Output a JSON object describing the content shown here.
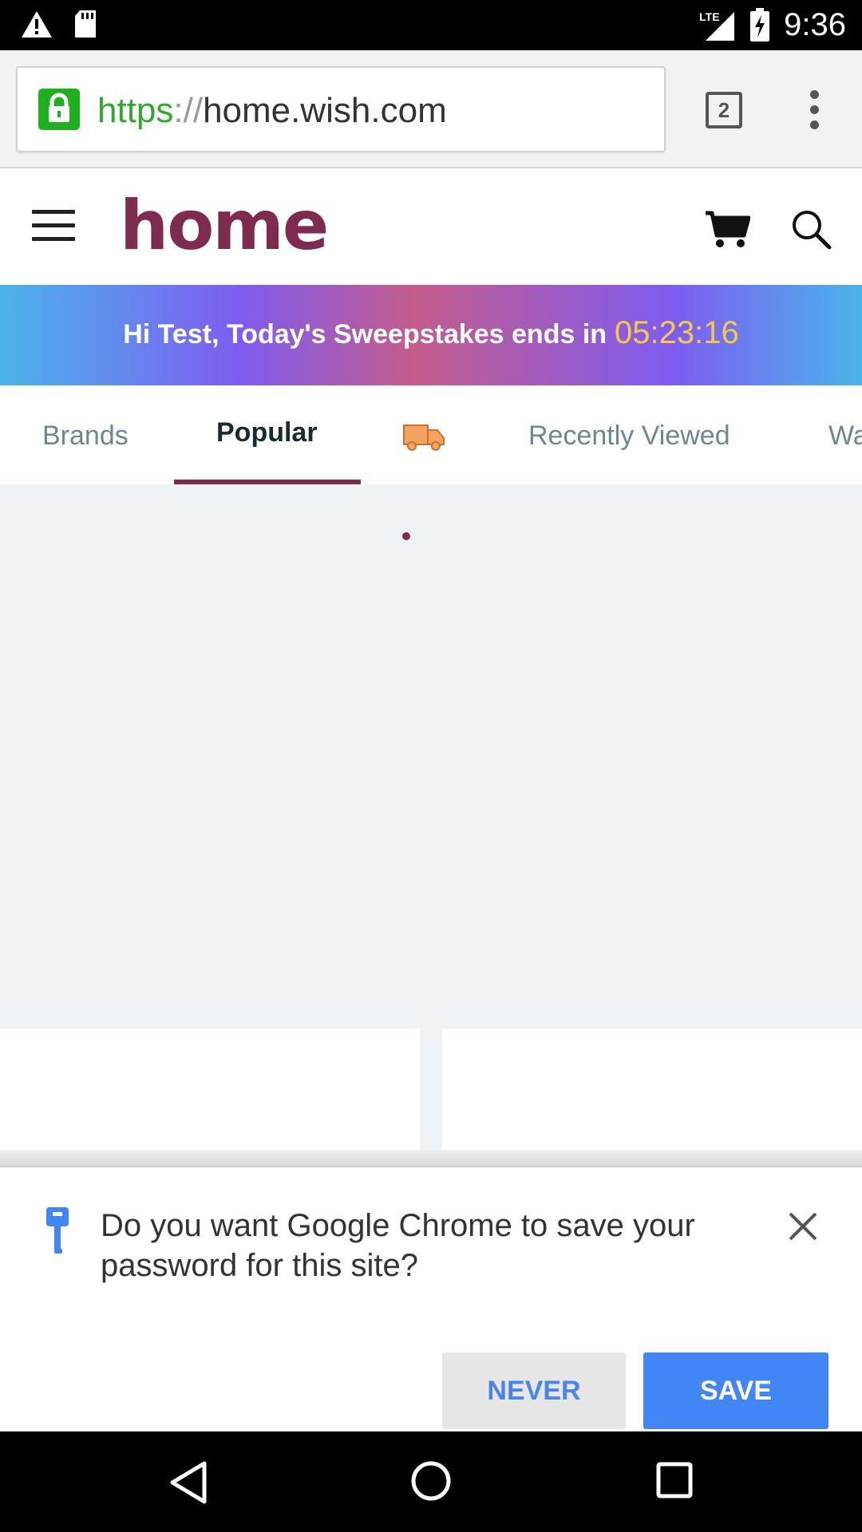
{
  "status_bar": {
    "time": "9:36",
    "network": "LTE",
    "icons": [
      "warning-icon",
      "sd-card-icon",
      "signal-icon",
      "battery-charging-icon"
    ]
  },
  "browser": {
    "url_scheme": "https",
    "url_separator": "://",
    "url_host": "home.wish.com",
    "tab_count": "2",
    "icons": [
      "lock-icon",
      "tab-switcher-icon",
      "menu-kebab-icon"
    ]
  },
  "site": {
    "logo": "home",
    "brand_color": "#7f2a4f",
    "icons": [
      "hamburger-menu-icon",
      "cart-icon",
      "search-icon"
    ]
  },
  "banner": {
    "message": "Hi Test, Today's Sweepstakes ends in",
    "countdown": "05:23:16"
  },
  "tabs": [
    {
      "label": "Brands",
      "active": false
    },
    {
      "label": "Popular",
      "active": true
    },
    {
      "label": "",
      "icon": "truck-icon",
      "active": false
    },
    {
      "label": "Recently Viewed",
      "active": false
    },
    {
      "label": "Wa",
      "active": false
    }
  ],
  "password_prompt": {
    "message": "Do you want Google Chrome to save your password for this site?",
    "never_label": "NEVER",
    "save_label": "SAVE",
    "accent": "#4285f4"
  },
  "nav_bar": {
    "icons": [
      "back-icon",
      "home-icon",
      "recents-icon"
    ]
  }
}
